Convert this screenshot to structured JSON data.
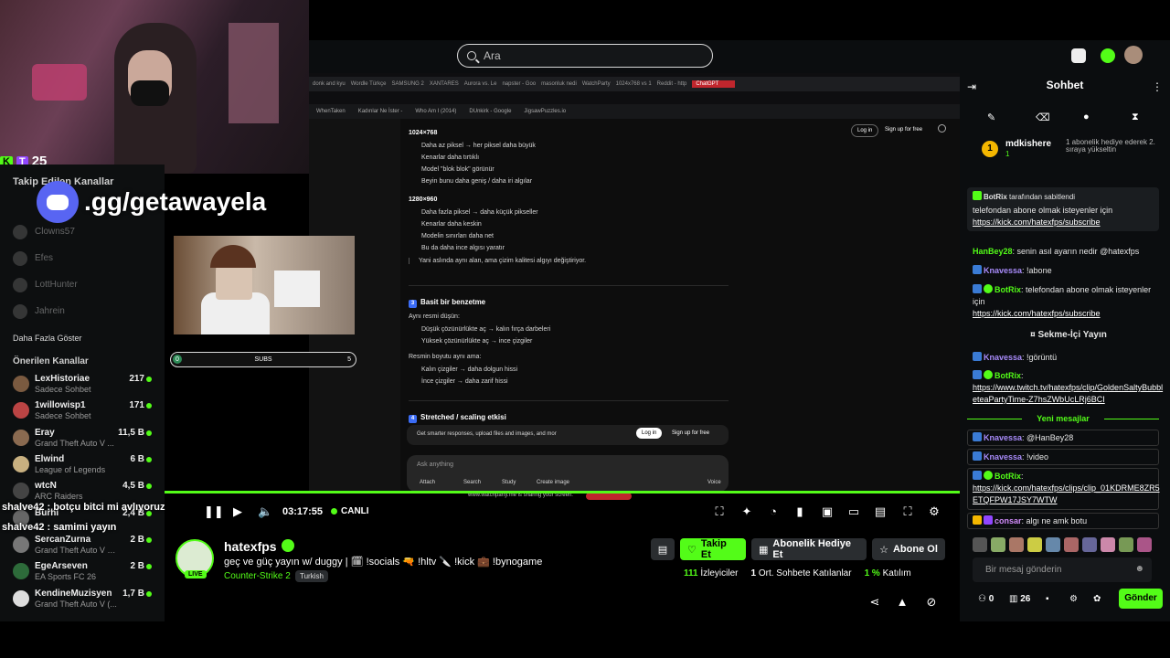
{
  "search": {
    "placeholder": "Ara"
  },
  "overlay": {
    "badge_count": "25",
    "discord": ".gg/getawayela",
    "discord_shadow": "ynogame"
  },
  "sidebar": {
    "followed_header": "Takip Edilen Kanallar",
    "followed_offline": [
      "Clowns57",
      "Efes",
      "LottHunter",
      "Jahrein"
    ],
    "show_more": "Daha Fazla Göster",
    "recommended_header": "Önerilen Kanallar",
    "recommended": [
      {
        "name": "LexHistoriae",
        "sub": "Sadece Sohbet",
        "viewers": "217"
      },
      {
        "name": "1willowisp1",
        "sub": "Sadece Sohbet",
        "viewers": "171"
      },
      {
        "name": "Eray",
        "sub": "Grand Theft Auto V ...",
        "viewers": "11,5 B"
      },
      {
        "name": "Elwind",
        "sub": "League of Legends",
        "viewers": "6 B"
      },
      {
        "name": "wtcN",
        "sub": "ARC Raiders",
        "viewers": "4,5 B"
      },
      {
        "name": "Burhi",
        "sub": "",
        "viewers": "2,4 B"
      },
      {
        "name": "SercanZurna",
        "sub": "Grand Theft Auto V (G...",
        "viewers": "2 B"
      },
      {
        "name": "EgeArseven",
        "sub": "EA Sports FC 26",
        "viewers": "2 B"
      },
      {
        "name": "KendineMuzisyen",
        "sub": "Grand Theft Auto V (...",
        "viewers": "1,7 B"
      }
    ]
  },
  "overlay_chat": [
    "shalve42 : botçu bitci mi avlıyoruz",
    "shalve42 : samimi yayın"
  ],
  "stream_screen": {
    "tabs": [
      "donk and kyu",
      "Wordle Türkçe",
      "SAMSUNG 2",
      "XANTARES",
      "Aurora vs. Le",
      "napster - Goo",
      "masonluk nedi",
      "WatchParty",
      "1024x768 vs 1",
      "Reddit - http",
      "ChatGPT"
    ],
    "bookmarks": [
      "WhenTaken",
      "Kadınlar Ne İster -",
      "Who Am I (2014)",
      "DUnkirk - Google",
      "JigsawPuzzles.io"
    ],
    "login": "Log in",
    "signup": "Sign up for free",
    "res1": "1024×768",
    "res1_items": [
      "Daha az piksel → her piksel daha büyük",
      "Kenarlar daha tırtıklı",
      "Model \"blok blok\" görünür",
      "Beyin bunu daha geniş / daha iri algılar"
    ],
    "res2": "1280×960",
    "res2_items": [
      "Daha fazla piksel → daha küçük pikseller",
      "Kenarlar daha keskin",
      "Modelin sınırları daha net",
      "Bu da daha ince algısı yaratır"
    ],
    "quote": "Yani aslında aynı alan, ama çizim kalitesi algıyı değiştiriyor.",
    "h3": "Basit bir benzetme",
    "h3_num": "3",
    "analog_intro": "Aynı resmi düşün:",
    "analog_items": [
      "Düşük çözünürlükte aç → kalın fırça darbeleri",
      "Yüksek çözünürlükte aç → ince çizgiler"
    ],
    "analog2_intro": "Resmin boyutu aynı ama:",
    "analog2_items": [
      "Kalın çizgiler → daha dolgun hissi",
      "İnce çizgiler → daha zarif hissi"
    ],
    "h4": "Stretched / scaling etkisi",
    "h4_num": "4",
    "banner": "Get smarter responses, upload files and images, and mor",
    "ask": "Ask anything",
    "actions": [
      "Attach",
      "Search",
      "Study",
      "Create image"
    ],
    "voice": "Voice",
    "sharing": "www.watchparty.me is sharing your screen.",
    "subs_label": "SUBS",
    "subs_left": "0",
    "subs_right": "5",
    "subs_progress": 0
  },
  "player": {
    "time": "03:17:55",
    "live": "CANLI"
  },
  "stream": {
    "name": "hatexfps",
    "live_tag": "LIVE",
    "title": "geç ve güç yayın w/ duggy | 🗓 !socials 🔫 !hltv 🔪 !kick 💼 !bynogame",
    "category": "Counter-Strike 2",
    "language": "Turkish",
    "follow": "Takip Et",
    "gift": "Abonelik Hediye Et",
    "subscribe": "Abone Ol",
    "viewers_n": "111",
    "viewers_l": "İzleyiciler",
    "chatters_n": "1",
    "chatters_l": "Ort. Sohbete Katılanlar",
    "participation_n": "1 %",
    "participation_l": "Katılım"
  },
  "chat": {
    "title": "Sohbet",
    "gift_rank": "1",
    "gift_user": "mdkishere",
    "gift_count": "1",
    "gift_desc": "1 abonelik hediye ederek 2. sıraya yükseltin",
    "pinned_by": "BotRix",
    "pinned_suffix": "tarafından sabitlendi",
    "pinned_text": "telefondan abone olmak isteyenler için",
    "pinned_link": "https://kick.com/hatexfps/subscribe",
    "messages": [
      {
        "user": "HanBey28",
        "text": "senin asıl ayarın nedir @hatexfps"
      },
      {
        "user": "Knavessa",
        "text": "!abone"
      },
      {
        "user": "BotRix",
        "text": "telefondan abone olmak isteyenler için",
        "link": "https://kick.com/hatexfps/subscribe"
      },
      {
        "user": "",
        "text": "Sekme-İçi Yayın"
      },
      {
        "user": "Knavessa",
        "text": "!görüntü"
      },
      {
        "user": "BotRix",
        "text": "",
        "link": "https://www.twitch.tv/hatexfps/clip/GoldenSaltyBubbleteaPartyTime-Z7hsZWbUcLRj6BCI"
      }
    ],
    "new_messages": "Yeni mesajlar",
    "new": [
      {
        "user": "Knavessa",
        "text": "@HanBey28"
      },
      {
        "user": "Knavessa",
        "text": "!video"
      },
      {
        "user": "BotRix",
        "text": "",
        "link": "https://kick.com/hatexfps/clips/clip_01KDRME8ZR5ETQFPW17JSY7WTW"
      },
      {
        "user": "consar",
        "text": "algı ne amk botu"
      }
    ],
    "input_placeholder": "Bir mesaj gönderin",
    "points": "0",
    "store_count": "26",
    "send": "Gönder"
  },
  "colors": {
    "accent": "#53fc18",
    "bg": "#0b0d0f",
    "kick_purple": "#9146ff",
    "discord": "#5865f2"
  }
}
